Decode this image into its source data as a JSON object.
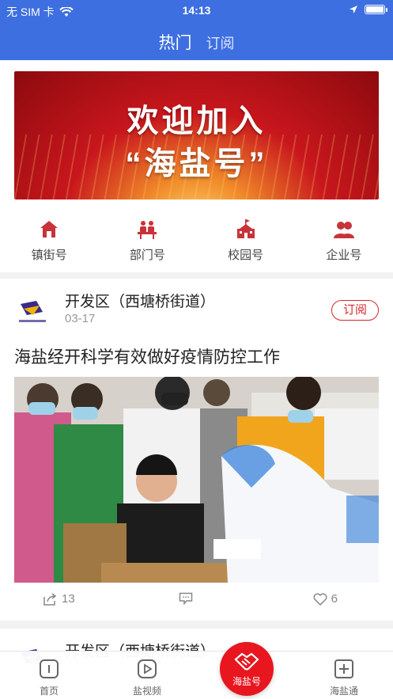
{
  "status_bar": {
    "carrier": "无 SIM 卡",
    "time": "14:13"
  },
  "header": {
    "tab_hot": "热门",
    "tab_subscribe": "订阅"
  },
  "banner": {
    "line1": "欢迎加入",
    "line2": "“海盐号”"
  },
  "categories": [
    {
      "label": "镇街号",
      "icon": "house-icon"
    },
    {
      "label": "部门号",
      "icon": "meeting-icon"
    },
    {
      "label": "校园号",
      "icon": "school-icon"
    },
    {
      "label": "企业号",
      "icon": "users-icon"
    }
  ],
  "post": {
    "author": "开发区（西塘桥街道）",
    "date": "03-17",
    "follow_label": "订阅",
    "title": "海盐经开科学有效做好疫情防控工作",
    "share_count": "13",
    "like_count": "6"
  },
  "post2": {
    "author": "开发区（西塘桥街道）"
  },
  "bottom_nav": [
    {
      "label": "首页",
      "icon": "home-icon"
    },
    {
      "label": "盐视频",
      "icon": "play-icon"
    },
    {
      "label": "海盐号",
      "icon": "handshake-icon"
    },
    {
      "label": "海盐通",
      "icon": "plus-square-icon"
    }
  ],
  "colors": {
    "header_blue": "#3d6fe0",
    "accent_red": "#d9262b",
    "icon_red": "#c8333a"
  }
}
